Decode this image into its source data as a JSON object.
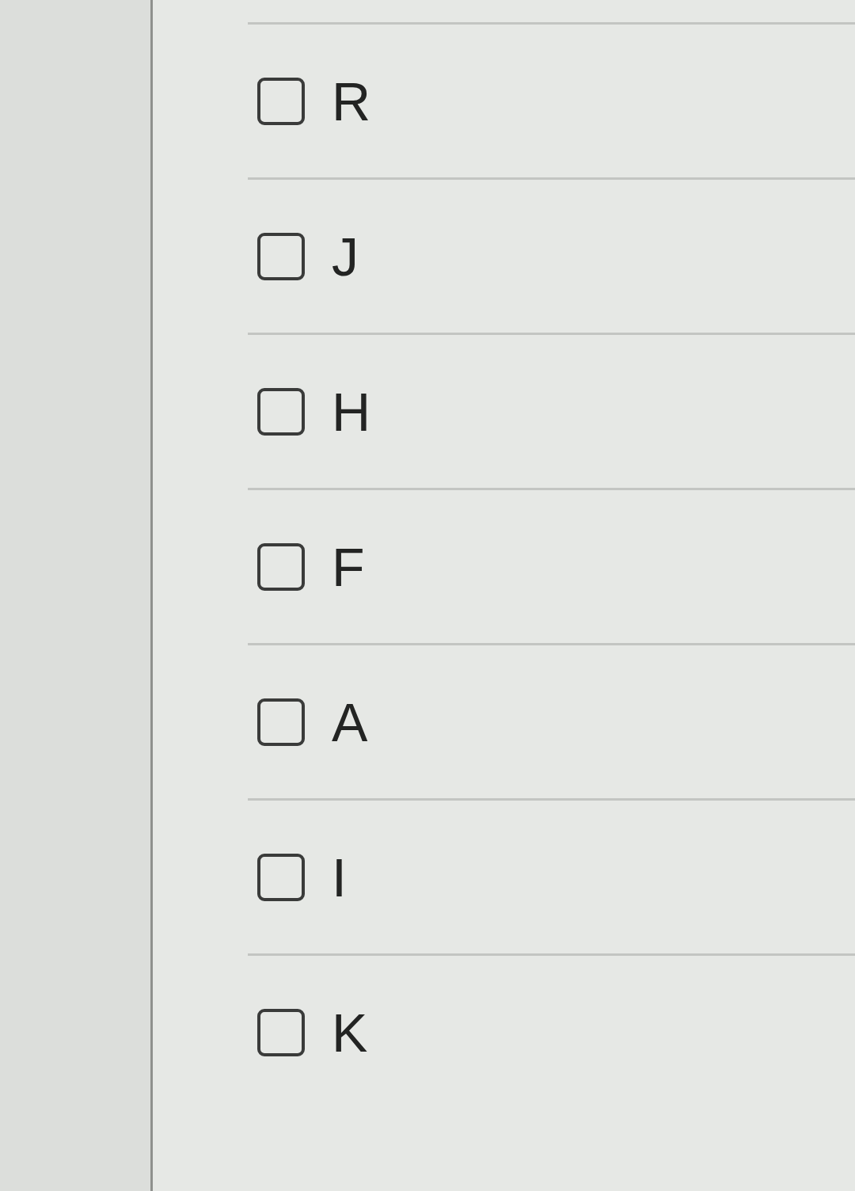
{
  "options": [
    {
      "label": "R",
      "checked": false
    },
    {
      "label": "J",
      "checked": false
    },
    {
      "label": "H",
      "checked": false
    },
    {
      "label": "F",
      "checked": false
    },
    {
      "label": "A",
      "checked": false
    },
    {
      "label": "I",
      "checked": false
    },
    {
      "label": "K",
      "checked": false
    }
  ]
}
